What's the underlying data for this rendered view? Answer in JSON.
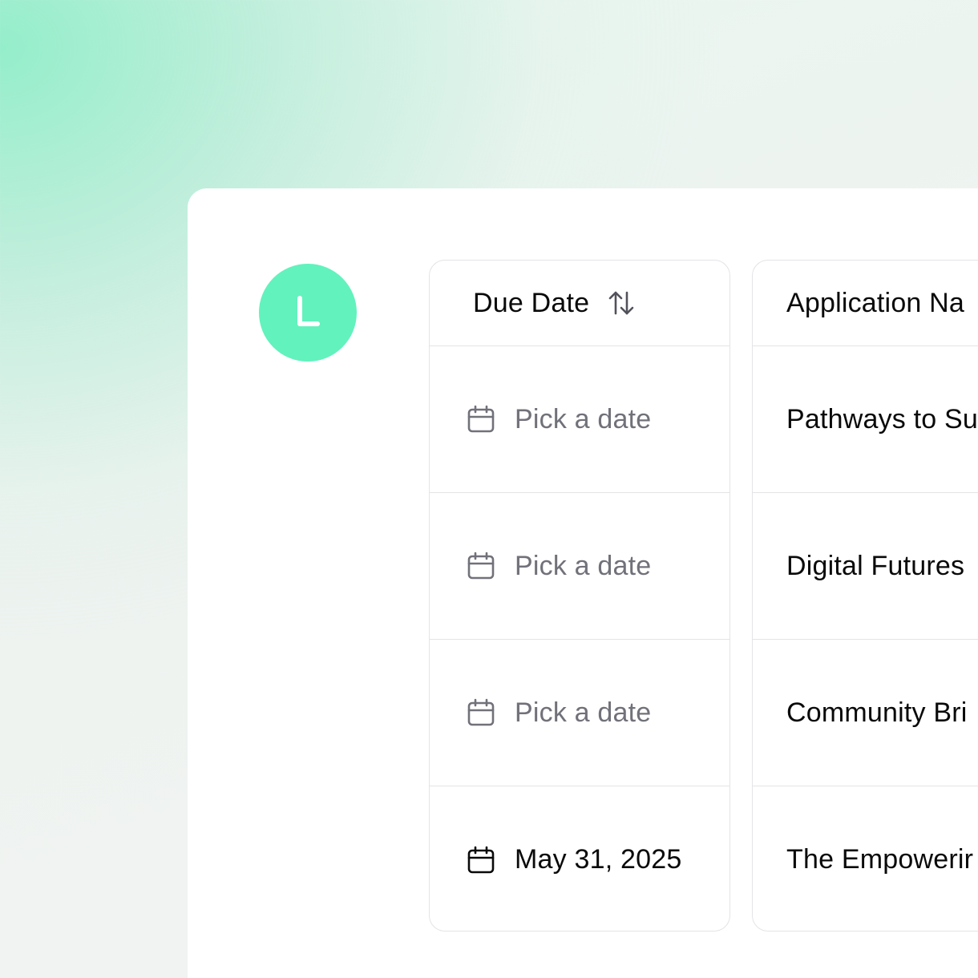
{
  "avatar": {
    "initial": "L",
    "color": "#62f2bd"
  },
  "table": {
    "due_date_header": "Due Date",
    "application_name_header": "Application Na",
    "rows": [
      {
        "due_date": "Pick a date",
        "due_date_set": false,
        "application_name": "Pathways to Su"
      },
      {
        "due_date": "Pick a date",
        "due_date_set": false,
        "application_name": "Digital Futures"
      },
      {
        "due_date": "Pick a date",
        "due_date_set": false,
        "application_name": "Community Bri"
      },
      {
        "due_date": "May 31, 2025",
        "due_date_set": true,
        "application_name": "The Empowerir"
      }
    ]
  },
  "icons": {
    "sort": "arrow-up-down-icon",
    "calendar": "calendar-icon",
    "clock": "clock-icon"
  },
  "colors": {
    "accent": "#62f2bd",
    "border": "#e4e4e7",
    "placeholder": "#71717a",
    "text": "#0a0a0a"
  }
}
